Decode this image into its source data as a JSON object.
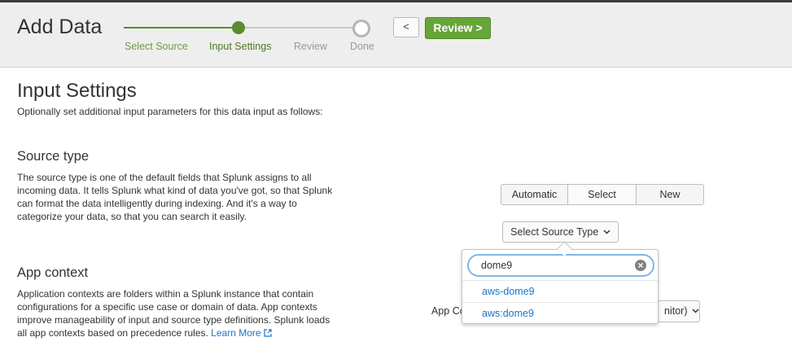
{
  "header": {
    "title": "Add Data",
    "back_label": "<",
    "review_label": "Review >"
  },
  "steps": [
    {
      "label": "Select Source",
      "state": "complete"
    },
    {
      "label": "Input Settings",
      "state": "current"
    },
    {
      "label": "Review",
      "state": "pending"
    },
    {
      "label": "Done",
      "state": "pending"
    }
  ],
  "main": {
    "heading": "Input Settings",
    "intro": "Optionally set additional input parameters for this data input as follows:",
    "source_type": {
      "heading": "Source type",
      "description": "The source type is one of the default fields that Splunk assigns to all incoming data. It tells Splunk what kind of data you've got, so that Splunk can format the data intelligently during indexing. And it's a way to categorize your data, so that you can search it easily.",
      "modes": [
        "Automatic",
        "Select",
        "New"
      ],
      "select_label": "Select Source Type",
      "search_value": "dome9",
      "results": [
        "aws-dome9",
        "aws:dome9"
      ]
    },
    "app_context": {
      "heading": "App context",
      "description": "Application contexts are folders within a Splunk instance that contain configurations for a specific use case or domain of data. App contexts improve manageability of input and source type definitions. Splunk loads all app contexts based on precedence rules.",
      "learn_more": "Learn More",
      "label_visible": "App Co",
      "select_visible": "nitor)"
    }
  },
  "colors": {
    "accent_green": "#65a637",
    "progress_green": "#5c8a2f",
    "link_blue": "#1a73c8"
  },
  "icons": {
    "dropdown": "chevron-down-icon",
    "clear": "clear-search-icon",
    "external": "external-link-icon"
  }
}
